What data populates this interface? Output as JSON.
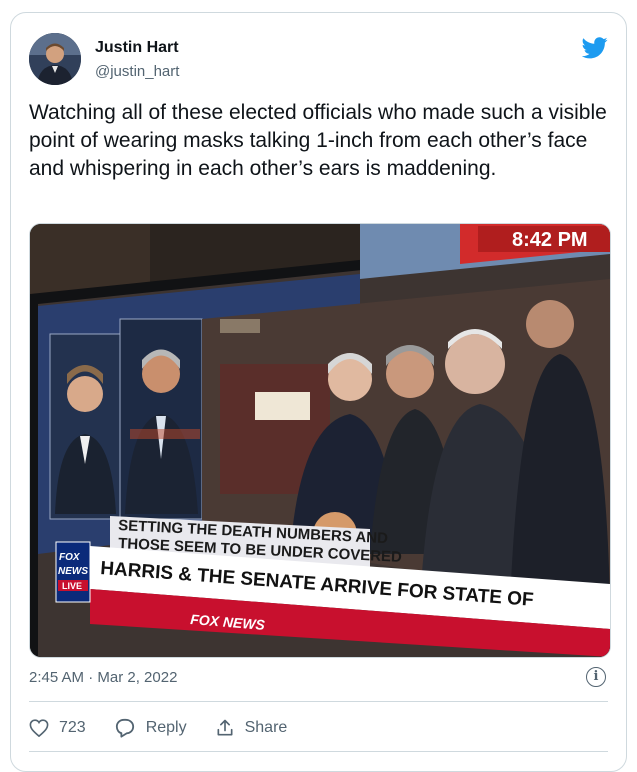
{
  "author": {
    "name": "Justin Hart",
    "handle": "@justin_hart"
  },
  "tweet": {
    "text": "Watching all of these elected officials who made such a visible point of wearing masks talking 1-inch from each other’s face and whispering in each other’s ears is maddening."
  },
  "media": {
    "clock": "8:42 PM",
    "chyron_upper_line1": "SETTING THE DEATH NUMBERS AND",
    "chyron_upper_line2": "THOSE SEEM TO BE UNDER COVERED",
    "chyron_main": "HARRIS & THE SENATE ARRIVE FOR STATE OF",
    "network_logo": "FOX NEWS",
    "live_label": "LIVE",
    "ticker_logo": "FOX NEWS"
  },
  "meta": {
    "timestamp": "2:45 AM · Mar 2, 2022"
  },
  "actions": {
    "like_count": "723",
    "reply_label": "Reply",
    "share_label": "Share"
  },
  "icons": {
    "bird": "twitter-bird-icon",
    "info": "info-icon",
    "heart": "heart-icon",
    "reply": "reply-icon",
    "share": "share-icon"
  },
  "colors": {
    "twitter_blue": "#1d9bf0",
    "text": "#0f1419",
    "secondary": "#536471",
    "border": "#cfd9de"
  }
}
